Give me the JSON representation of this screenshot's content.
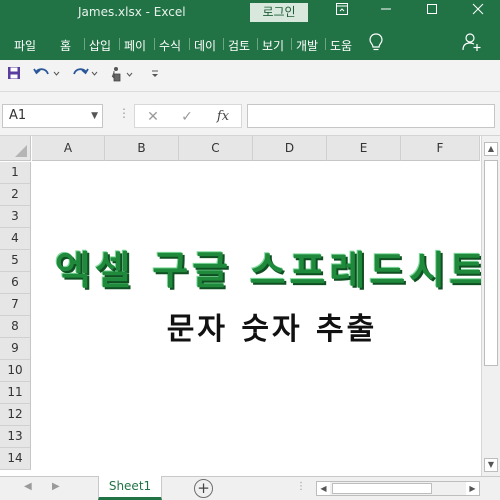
{
  "window": {
    "title": "James.xlsx  -  Excel",
    "login_label": "로그인",
    "icons": [
      "ribbon-display-icon",
      "minimize-icon",
      "maximize-icon",
      "close-icon"
    ]
  },
  "ribbon": {
    "tabs": [
      "파일",
      "홈",
      "삽입",
      "페이",
      "수식",
      "데이",
      "검토",
      "보기",
      "개발",
      "도움"
    ],
    "icons": [
      "lightbulb-icon",
      "share-person-icon"
    ]
  },
  "qat": {
    "icons": [
      "save-icon",
      "undo-icon",
      "redo-icon",
      "touch-mode-icon",
      "customize-qat-icon"
    ]
  },
  "formula_bar": {
    "name_box": "A1",
    "cancel_glyph": "✕",
    "enter_glyph": "✓",
    "fx_glyph": "fx",
    "formula_value": ""
  },
  "sheet": {
    "columns": [
      "A",
      "B",
      "C",
      "D",
      "E",
      "F"
    ],
    "rows": [
      "1",
      "2",
      "3",
      "4",
      "5",
      "6",
      "7",
      "8",
      "9",
      "10",
      "11",
      "12",
      "13",
      "14"
    ],
    "headline": "엑셀 구글 스프레드시트",
    "subheadline": "문자 숫자 추출",
    "headline_color": "#1f8a3c"
  },
  "sheet_tabs": {
    "active": "Sheet1",
    "add_label": "+"
  },
  "colors": {
    "excel_green": "#217346"
  }
}
